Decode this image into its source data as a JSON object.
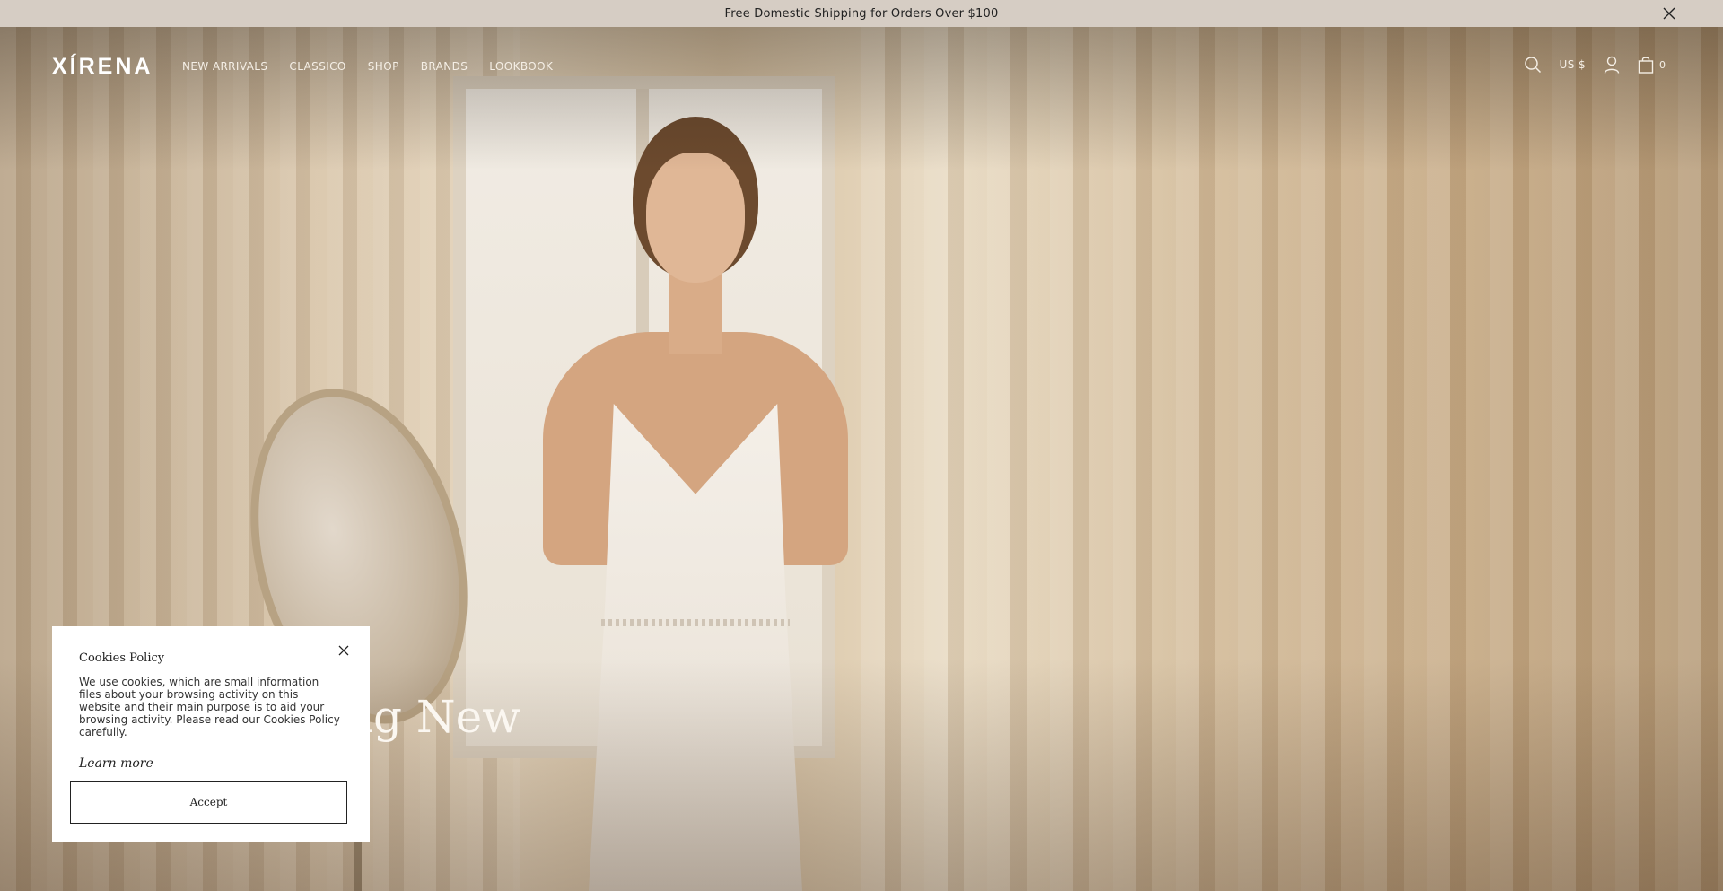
{
  "announcement": {
    "text": "Free Domestic Shipping for Orders Over $100"
  },
  "header": {
    "logo": "XÍRENA",
    "nav": [
      "NEW ARRIVALS",
      "CLASSICO",
      "SHOP",
      "BRANDS",
      "LOOKBOOK"
    ],
    "currency": "US $",
    "cart_count": "0"
  },
  "hero": {
    "headline_visible": "ng New"
  },
  "cookie": {
    "title": "Cookies Policy",
    "text": "We use cookies, which are small information files about your browsing activity on this website and their main purpose is to aid your browsing activity. Please read our Cookies Policy carefully.",
    "learn_more": "Learn more",
    "accept": "Accept"
  },
  "colors": {
    "announcement_bg": "#d6cdc4",
    "header_text": "#f5efe6",
    "dialog_bg": "#ffffff"
  }
}
